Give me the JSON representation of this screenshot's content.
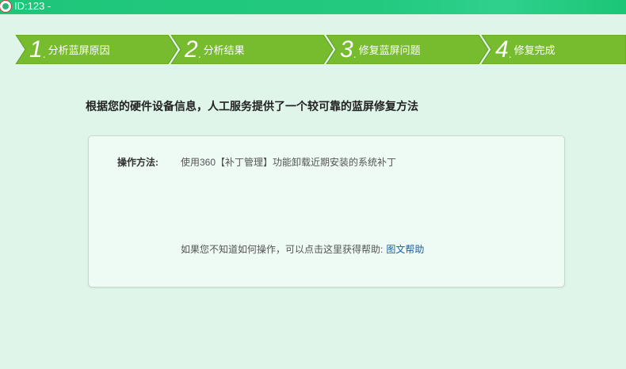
{
  "window": {
    "title": "ID:123 -"
  },
  "steps": [
    {
      "num": "1",
      "label": "分析蓝屏原因"
    },
    {
      "num": "2",
      "label": "分析结果"
    },
    {
      "num": "3",
      "label": "修复蓝屏问题"
    },
    {
      "num": "4",
      "label": "修复完成"
    }
  ],
  "heading": "根据您的硬件设备信息，人工服务提供了一个较可靠的蓝屏修复方法",
  "card": {
    "method_label": "操作方法:",
    "method_text": "使用360【补丁管理】功能卸载近期安装的系统补丁",
    "help_text": "如果您不知道如何操作，可以点击这里获得帮助:",
    "help_link": "图文帮助"
  },
  "colors": {
    "titlebar": "#1ec67a",
    "steps": "#77bb2e",
    "background": "#dff5ea",
    "link": "#1b5fa8"
  }
}
